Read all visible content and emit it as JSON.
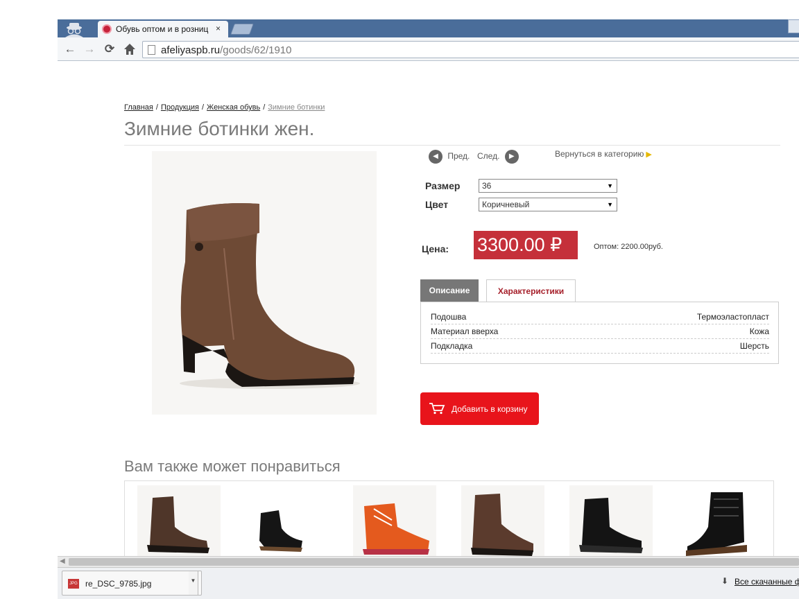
{
  "browser": {
    "tab_title": "Обувь оптом и в розниц",
    "tab_close": "×",
    "url_host": "afeliyaspb.ru",
    "url_path": "/goods/62/1910"
  },
  "breadcrumb": {
    "items": [
      "Главная",
      "Продукция",
      "Женская обувь"
    ],
    "current": "Зимние ботинки",
    "separator": "/"
  },
  "product": {
    "title": "Зимние ботинки жен.",
    "prev_label": "Пред.",
    "next_label": "След.",
    "back_label": "Вернуться в категорию",
    "options": {
      "size_label": "Размер",
      "size_value": "36",
      "color_label": "Цвет",
      "color_value": "Коричневый"
    },
    "price_label": "Цена:",
    "price": "3300.00 ₽",
    "wholesale": "Оптом: 2200.00руб.",
    "tabs": [
      "Описание",
      "Характеристики"
    ],
    "specs": [
      {
        "key": "Подошва",
        "value": "Термоэластопласт"
      },
      {
        "key": "Материал вверха",
        "value": "Кожа"
      },
      {
        "key": "Подкладка",
        "value": "Шерсть"
      }
    ],
    "add_to_cart": "Добавить в корзину"
  },
  "related": {
    "title": "Вам также может понравиться"
  },
  "downloads": {
    "file_name": "re_DSC_9785.jpg",
    "file_type": "JPG",
    "show_all": "Все скачанные ф"
  },
  "colors": {
    "accent": "#c5303a",
    "cart": "#e8141b",
    "tab_active_text": "#a6202b",
    "chrome_blue": "#4a6d9a"
  }
}
